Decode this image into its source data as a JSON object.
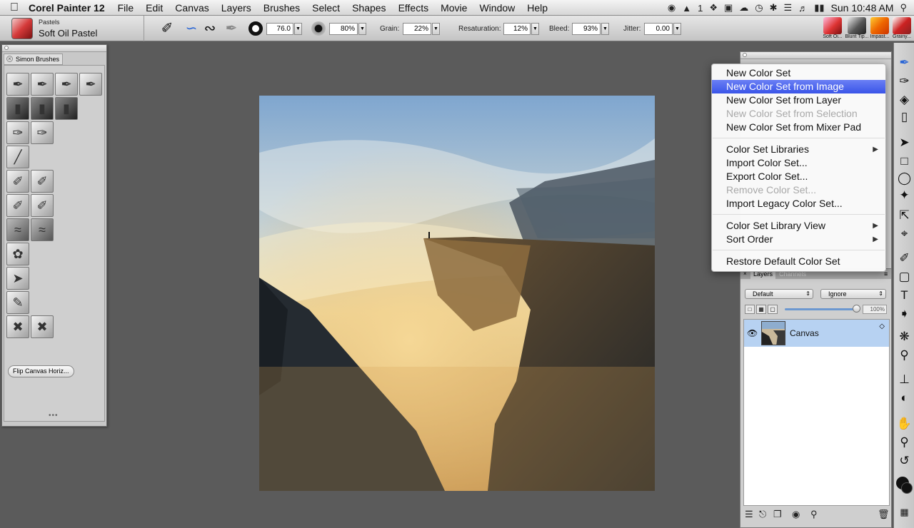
{
  "menubar": {
    "app_name": "Corel Painter 12",
    "menus": [
      "File",
      "Edit",
      "Canvas",
      "Layers",
      "Brushes",
      "Select",
      "Shapes",
      "Effects",
      "Movie",
      "Window",
      "Help"
    ],
    "status_extra": "1",
    "clock": "Sun 10:48 AM"
  },
  "propbar": {
    "brush_category": "Pastels",
    "brush_variant": "Soft Oil Pastel",
    "size_value": "76.0",
    "opacity_value": "80%",
    "grain_label": "Grain:",
    "grain_value": "22%",
    "resaturation_label": "Resaturation:",
    "resaturation_value": "12%",
    "bleed_label": "Bleed:",
    "bleed_value": "93%",
    "jitter_label": "Jitter:",
    "jitter_value": "0.00",
    "recent_brushes": [
      "Soft Oi...",
      "Blunt Tip...",
      "Impast...",
      "Grainy..."
    ]
  },
  "custom_palette": {
    "tab_label": "Simon Brushes",
    "button_label": "Flip Canvas Horiz..."
  },
  "color_set_menu": {
    "items": [
      {
        "label": "New Color Set",
        "state": "normal",
        "submenu": false
      },
      {
        "label": "New Color Set from Image",
        "state": "highlighted",
        "submenu": false
      },
      {
        "label": "New Color Set from Layer",
        "state": "normal",
        "submenu": false
      },
      {
        "label": "New Color Set from Selection",
        "state": "disabled",
        "submenu": false
      },
      {
        "label": "New Color Set from Mixer Pad",
        "state": "normal",
        "submenu": false
      },
      {
        "label": "Color Set Libraries",
        "state": "normal",
        "submenu": true
      },
      {
        "label": "Import Color Set...",
        "state": "normal",
        "submenu": false
      },
      {
        "label": "Export Color Set...",
        "state": "normal",
        "submenu": false
      },
      {
        "label": "Remove Color Set...",
        "state": "disabled",
        "submenu": false
      },
      {
        "label": "Import Legacy Color Set...",
        "state": "normal",
        "submenu": false
      },
      {
        "label": "Color Set Library View",
        "state": "normal",
        "submenu": true
      },
      {
        "label": "Sort Order",
        "state": "normal",
        "submenu": true
      },
      {
        "label": "Restore Default Color Set",
        "state": "normal",
        "submenu": false
      }
    ]
  },
  "layers_panel": {
    "tab_layers": "Layers",
    "tab_channels": "Channels",
    "composite_method": "Default",
    "preserve_mode": "Ignore",
    "opacity": "100%",
    "layers": [
      {
        "name": "Canvas",
        "selected": true,
        "visible": true
      }
    ]
  },
  "colors": {
    "accent_highlight": "#3a55e8",
    "layer_selected": "#b7d2f2",
    "desktop_gray": "#5b5b5b",
    "main_color": "#111111",
    "additional_color": "#ffffff"
  }
}
